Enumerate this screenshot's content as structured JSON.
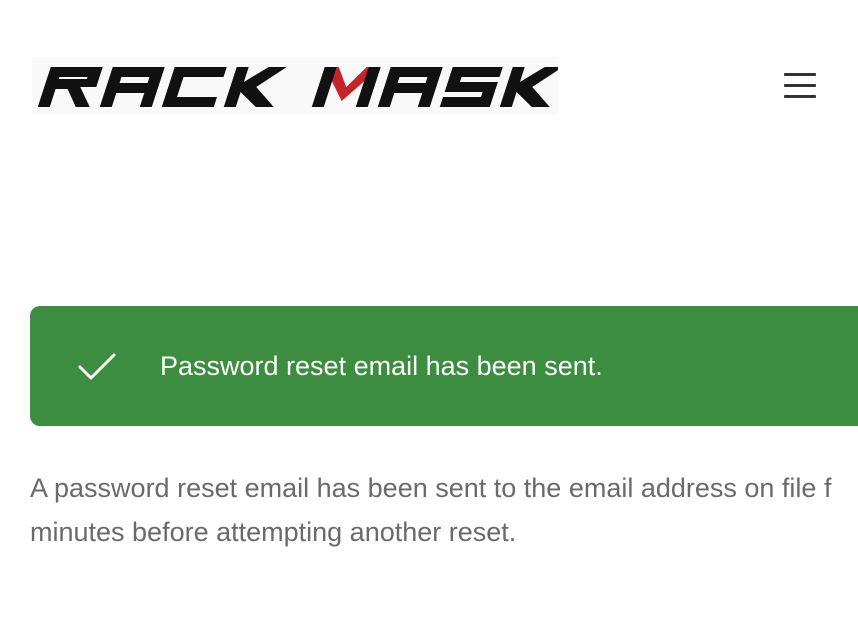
{
  "header": {
    "logo_text": "RACK MASK",
    "menu_icon": "hamburger-menu-icon"
  },
  "notice": {
    "icon": "checkmark-icon",
    "message": "Password reset email has been sent.",
    "color": "#3d8d40"
  },
  "content": {
    "line1": "A password reset email has been sent to the email address on file f",
    "line2": "minutes before attempting another reset."
  },
  "colors": {
    "logo_black": "#111111",
    "logo_red": "#c4242a",
    "text_gray": "#6a6a6a"
  }
}
